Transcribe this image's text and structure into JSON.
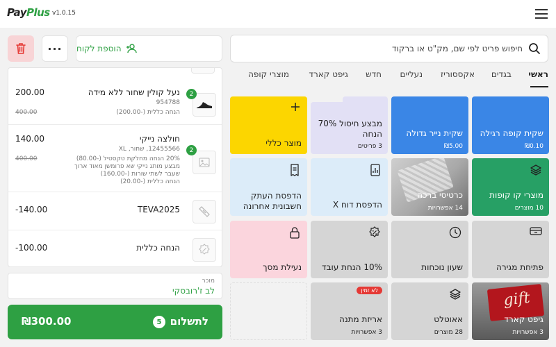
{
  "app": {
    "logo_main": "PayPlus",
    "version": "v1.0.15"
  },
  "header": {
    "menu_icon": "hamburger-icon"
  },
  "left": {
    "add_customer_label": "הוספת לקוח",
    "more_label": "···",
    "cart_items": [
      {
        "name": "נעל קולין שחור ללא מידה",
        "sku": "954788",
        "discount": "הנחה כללית (-200.00)",
        "price": "200.00",
        "old_price": "400.00",
        "qty": "2"
      },
      {
        "name": "חולצה נייקי",
        "sku": "12455566, שחור, XL",
        "discount_lines": [
          "20% הנחה מחלקת טקסטיל (-80.00)",
          "מבצע מותג נייקי שא פרומשן מאוד ארוך",
          "שעבר לשתי שורות (-160.00)",
          "הנחה כללית (-20.00)"
        ],
        "price": "140.00",
        "old_price": "400.00",
        "qty": "2"
      },
      {
        "name": "TEVA2025",
        "price": "-140.00"
      },
      {
        "name": "הנחה כללית",
        "price": "-100.00"
      }
    ],
    "seller_label": "מוכר",
    "seller_name": "לב ז'רובסקי",
    "pay_label": "לתשלום",
    "pay_count": "5",
    "pay_total": "₪300.00"
  },
  "search": {
    "placeholder": "חיפוש פריט לפי שם, מק\"ט או ברקוד"
  },
  "tabs": [
    "ראשי",
    "בגדים",
    "אקססוריז",
    "נעליים",
    "חדש",
    "גיפט קארד",
    "מוצרי קופה"
  ],
  "tiles": [
    {
      "title": "שקית קופה רגילה",
      "sub": "₪0.10"
    },
    {
      "title": "שקית נייר גדולה",
      "sub": "₪5.00"
    },
    {
      "title": "מבצע חיסול 70% הנחה",
      "sub": "3 פריטים"
    },
    {
      "title": "מוצר כללי",
      "sub": ""
    },
    {
      "title": "מוצרי קו קופות",
      "sub": "10 מוצרים"
    },
    {
      "title": "כרטיסי ברכה",
      "sub": "14 אפשרויות"
    },
    {
      "title": "הדפסת דוח X",
      "sub": ""
    },
    {
      "title": "הדפסת העתק חשבונית אחרונה",
      "sub": ""
    },
    {
      "title": "פתיחת מגירה",
      "sub": ""
    },
    {
      "title": "שעון נוכחות",
      "sub": ""
    },
    {
      "title": "10% הנחת עובד",
      "sub": ""
    },
    {
      "title": "נעילת מסך",
      "sub": ""
    },
    {
      "title": "גיפט קארד",
      "sub": "3 אפשרויות",
      "art": "gift"
    },
    {
      "title": "אאוטלט",
      "sub": "28 מוצרים"
    },
    {
      "title": "אריזת מתנה",
      "sub": "3 אפשרויות",
      "tag": "לא זמין"
    }
  ],
  "colors": {
    "green": "#2ea043",
    "blue": "#3a86e6",
    "yellow": "#fcd600",
    "lavender": "#e2e0f5",
    "lightblue": "#dcecf9",
    "pink": "#fbd5dd",
    "grey": "#d5d5d5",
    "red": "#e53935"
  }
}
